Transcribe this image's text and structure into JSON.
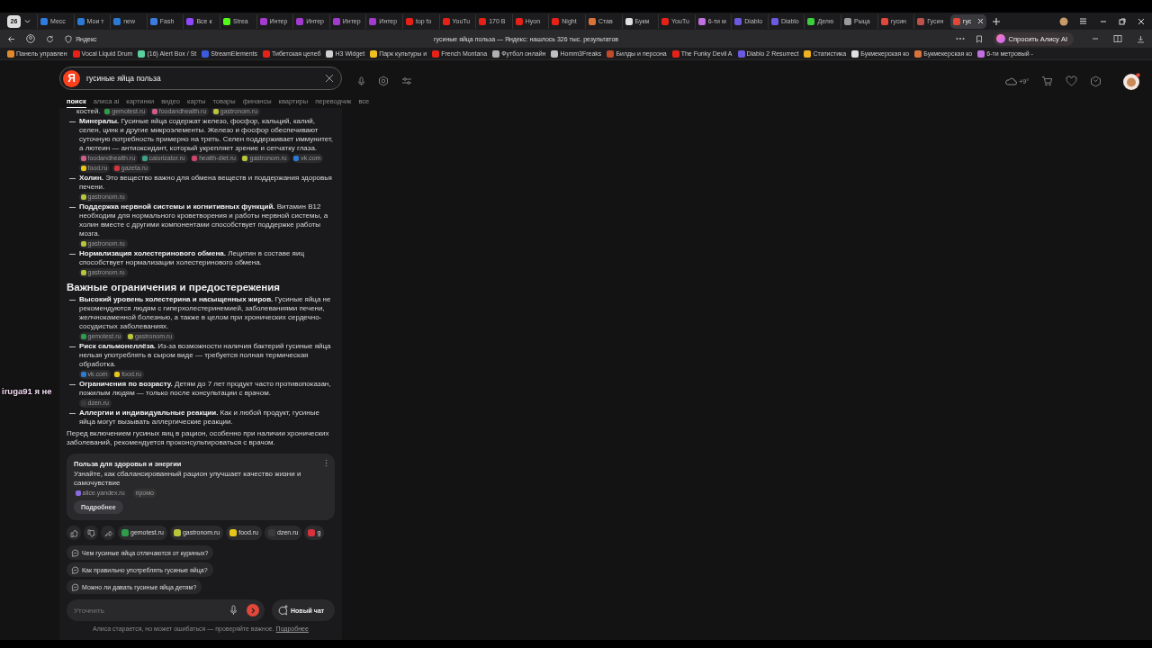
{
  "browser": {
    "tab_count": "26",
    "tabs": [
      {
        "label": "Месс",
        "selected": false,
        "color": "#2f7be0"
      },
      {
        "label": "Мои т",
        "selected": false,
        "color": "#2a7bd6"
      },
      {
        "label": "new",
        "selected": false,
        "color": "#2a7bd6"
      },
      {
        "label": "Fash",
        "selected": false,
        "color": "#3a7ce0"
      },
      {
        "label": "Все к",
        "selected": false,
        "color": "#9146ff"
      },
      {
        "label": "Strea",
        "selected": false,
        "color": "#53fc18"
      },
      {
        "label": "Интер",
        "selected": false,
        "color": "#a43bd0"
      },
      {
        "label": "Интер",
        "selected": false,
        "color": "#a43bd0"
      },
      {
        "label": "Интер",
        "selected": false,
        "color": "#a43bd0"
      },
      {
        "label": "Интер",
        "selected": false,
        "color": "#a43bd0"
      },
      {
        "label": "top fo",
        "selected": false,
        "color": "#e62117"
      },
      {
        "label": "YouTu",
        "selected": false,
        "color": "#e62117"
      },
      {
        "label": "170 B",
        "selected": false,
        "color": "#e62117"
      },
      {
        "label": "Hyon",
        "selected": false,
        "color": "#e62117"
      },
      {
        "label": "Night",
        "selected": false,
        "color": "#e62117"
      },
      {
        "label": "Став",
        "selected": false,
        "color": "#d9733a"
      },
      {
        "label": "Букм",
        "selected": false,
        "color": "#e0e0e0"
      },
      {
        "label": "YouTu",
        "selected": false,
        "color": "#e62117"
      },
      {
        "label": "6-ти м",
        "selected": false,
        "color": "#c070e0"
      },
      {
        "label": "Diablo",
        "selected": false,
        "color": "#6a5ae0"
      },
      {
        "label": "Diablo",
        "selected": false,
        "color": "#6a5ae0"
      },
      {
        "label": "Делю",
        "selected": false,
        "color": "#3ccf3c"
      },
      {
        "label": "Рыца",
        "selected": false,
        "color": "#9a9a9a"
      },
      {
        "label": "гусин",
        "selected": false,
        "color": "#e3473a"
      },
      {
        "label": "Гусин",
        "selected": false,
        "color": "#c0504a"
      },
      {
        "label": "гус",
        "selected": true,
        "color": "#e3473a"
      }
    ],
    "address": "Яндекс",
    "page_title": "гусиные яйца польза — Яндекс: нашлось 326 тыс. результатов",
    "alice_button": "Спросить Алису AI",
    "bookmarks": [
      {
        "label": "Панель управлен",
        "color": "#e08a2a"
      },
      {
        "label": "Vocal Liquid Drum",
        "color": "#e62117"
      },
      {
        "label": "(16) Alert Box / St",
        "color": "#5ad0a0"
      },
      {
        "label": "StreamElements",
        "color": "#3a5ae0"
      },
      {
        "label": "Тибетская целеб",
        "color": "#e62117"
      },
      {
        "label": "H3 Widget",
        "color": "#d0d0d0"
      },
      {
        "label": "Парк культуры и",
        "color": "#f0c020"
      },
      {
        "label": "French Montana",
        "color": "#e62117"
      },
      {
        "label": "Футбол онлайн",
        "color": "#b0b0b0"
      },
      {
        "label": "Homm3Freaks",
        "color": "#c0c0c0"
      },
      {
        "label": "Билды и персона",
        "color": "#c04a2a"
      },
      {
        "label": "The Funky Devil A",
        "color": "#e62117"
      },
      {
        "label": "Diablo 2 Resurrect",
        "color": "#6a5ae0"
      },
      {
        "label": "Статистика",
        "color": "#f0b020"
      },
      {
        "label": "Букмекерская ко",
        "color": "#e0e0e0"
      },
      {
        "label": "Букмекерская ко",
        "color": "#d9733a"
      },
      {
        "label": "6-ти метровый -",
        "color": "#c070e0"
      }
    ]
  },
  "search": {
    "logo": "Я",
    "query": "гусиные яйца польза",
    "tabs": [
      {
        "label": "поиск",
        "selected": true
      },
      {
        "label": "алиса ai",
        "selected": false
      },
      {
        "label": "картинки",
        "selected": false
      },
      {
        "label": "видео",
        "selected": false
      },
      {
        "label": "карты",
        "selected": false
      },
      {
        "label": "товары",
        "selected": false
      },
      {
        "label": "финансы",
        "selected": false
      },
      {
        "label": "квартиры",
        "selected": false
      },
      {
        "label": "переводчик",
        "selected": false
      },
      {
        "label": "все",
        "selected": false
      }
    ]
  },
  "weather": "+9°",
  "answer": {
    "top_fragment": {
      "text": "костей.",
      "sources": [
        {
          "label": "gemotest.ru",
          "color": "#2e9d4a"
        },
        {
          "label": "foodandhealth.ru",
          "color": "#d05c8a"
        },
        {
          "label": "gastronom.ru",
          "color": "#b8c43a"
        }
      ]
    },
    "benefits": [
      {
        "text": "**Минералы.** Гусиные яйца содержат железо, фосфор, кальций, калий, селен, цинк и другие микроэлементы. Железо и фосфор обеспечивают суточную потребность примерно на треть. Селен поддерживает иммунитет, а лютеин — антиоксидант, который укрепляет зрение и сетчатку глаза.",
        "sources": [
          {
            "label": "foodandhealth.ru",
            "color": "#d05c8a"
          },
          {
            "label": "calorizator.ru",
            "color": "#3aa38a"
          },
          {
            "label": "health-diet.ru",
            "color": "#d0456a"
          },
          {
            "label": "gastronom.ru",
            "color": "#b8c43a"
          },
          {
            "label": "vk.com",
            "color": "#2a7bd6"
          },
          {
            "label": "food.ru",
            "color": "#e8c51a"
          },
          {
            "label": "gazeta.ru",
            "color": "#d6333a"
          }
        ]
      },
      {
        "text": "**Холин.** Это вещество важно для обмена веществ и поддержания здоровья печени.",
        "sources": [
          {
            "label": "gastronom.ru",
            "color": "#b8c43a"
          }
        ]
      },
      {
        "text": "**Поддержка нервной системы и когнитивных функций.** Витамин B12 необходим для нормального кроветворения и работы нервной системы, а холин вместе с другими компонентами способствует поддержке работы мозга.",
        "sources": [
          {
            "label": "gastronom.ru",
            "color": "#b8c43a"
          }
        ]
      },
      {
        "text": "**Нормализация холестеринового обмена.** Лецитин в составе яиц способствует нормализации холестеринового обмена.",
        "sources": [
          {
            "label": "gastronom.ru",
            "color": "#b8c43a"
          }
        ]
      }
    ],
    "heading": "Важные ограничения и предостережения",
    "warnings": [
      {
        "text": "**Высокий уровень холестерина и насыщенных жиров.** Гусиные яйца не рекомендуются людям с гиперхолестеринемией, заболеваниями печени, желчнокаменной болезнью, а также в целом при хронических сердечно-сосудистых заболеваниях.",
        "sources": [
          {
            "label": "gemotest.ru",
            "color": "#2e9d4a"
          },
          {
            "label": "gastronom.ru",
            "color": "#b8c43a"
          }
        ]
      },
      {
        "text": "**Риск сальмонеллёза.** Из-за возможности наличия бактерий гусиные яйца нельзя употреблять в сыром виде — требуется полная термическая обработка.",
        "sources": [
          {
            "label": "vk.com",
            "color": "#2a7bd6"
          },
          {
            "label": "food.ru",
            "color": "#e8c51a"
          }
        ]
      },
      {
        "text": "**Ограничения по возрасту.** Детям до 7 лет продукт часто противопоказан, пожилым людям — только после консультации с врачом.",
        "sources": [
          {
            "label": "dzen.ru",
            "color": "#3a3a3a"
          }
        ]
      },
      {
        "text": "**Аллергии и индивидуальные реакции.** Как и любой продукт, гусиные яйца могут вызывать аллергические реакции."
      }
    ],
    "conclusion": "Перед включением гусиных яиц в рацион, особенно при наличии хронических заболеваний, рекомендуется проконсультироваться с врачом.",
    "promo": {
      "title": "Польза для здоровья и энергии",
      "text": "Узнайте, как сбалансированный рацион улучшает качество жизни и самочувствие",
      "source": {
        "label": "alice.yandex.ru",
        "color": "#8a6be0"
      },
      "tag": "промо",
      "button": "Подробнее"
    },
    "sources": [
      {
        "label": "gemotest.ru",
        "color": "#2e9d4a"
      },
      {
        "label": "gastronom.ru",
        "color": "#b8c43a"
      },
      {
        "label": "food.ru",
        "color": "#e8c51a"
      },
      {
        "label": "dzen.ru",
        "color": "#3a3a3a"
      },
      {
        "label": "g",
        "color": "#d6333a"
      }
    ],
    "suggestions": [
      "Чем гусиные яйца отличаются от куриных?",
      "Как правильно употреблять гусиные яйца?",
      "Можно ли давать гусиные яйца детям?"
    ],
    "input": {
      "placeholder": "Уточнить"
    },
    "new_chat": "Новый чат",
    "disclaimer": "Алиса старается, но может ошибаться — проверяйте важное.",
    "disclaimer_link": "Подробнее"
  },
  "stream_overlay": {
    "text": "iruga91  я не"
  }
}
